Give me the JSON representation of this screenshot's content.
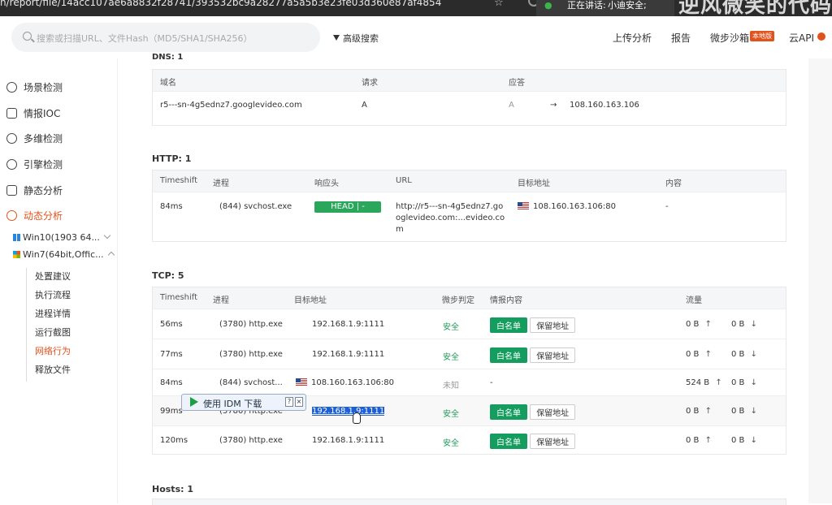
{
  "browser": {
    "url": "n/report/file/14acc107ae6a8832f28741/393532bc9a28277a5a5b3e23fe03d360e87af4854",
    "star_icon": "star-icon",
    "speaking_label": "正在讲话:",
    "speaker": "小迪安全;",
    "overlay_text": "逆风微笑的代码"
  },
  "header": {
    "search_placeholder": "搜索或扫描URL、文件Hash（MD5/SHA1/SHA256）",
    "advanced_search": "高级搜索",
    "nav": [
      "上传分析",
      "报告",
      "微步沙箱",
      "云API"
    ],
    "badge": "本地版"
  },
  "sidebar": {
    "items": [
      "场景检测",
      "情报IOC",
      "多维检测",
      "引擎检测",
      "静态分析",
      "动态分析"
    ],
    "vms": [
      "Win10(1903 64...",
      "Win7(64bit,Offic..."
    ],
    "subitems": [
      "处置建议",
      "执行流程",
      "进程详情",
      "运行截图",
      "网络行为",
      "释放文件"
    ]
  },
  "dns": {
    "title": "DNS: 1",
    "headers": [
      "域名",
      "请求",
      "应答"
    ],
    "rows": [
      {
        "domain": "r5---sn-4g5ednz7.googlevideo.com",
        "request": "A",
        "answer_type": "A",
        "answer": "108.160.163.106"
      }
    ]
  },
  "http": {
    "title": "HTTP: 1",
    "headers": [
      "Timeshift",
      "进程",
      "响应头",
      "URL",
      "目标地址",
      "内容"
    ],
    "rows": [
      {
        "time": "84ms",
        "process": "(844)  svchost.exe",
        "header": "HEAD  |  -",
        "url1": "http://r5---sn-4g5ednz7.go",
        "url2": "oglevideo.com:...evideo.co",
        "url3": "m",
        "target": "108.160.163.106:80",
        "content": "-"
      }
    ]
  },
  "tcp": {
    "title": "TCP: 5",
    "headers": [
      "Timeshift",
      "进程",
      "目标地址",
      "微步判定",
      "情报内容",
      "流量"
    ],
    "whitelist": "白名单",
    "reserved": "保留地址",
    "rows": [
      {
        "time": "56ms",
        "process": "(3780)  http.exe",
        "target": "192.168.1.9:1111",
        "verdict": "安全",
        "intel": "",
        "up": "0 B",
        "down": "0 B"
      },
      {
        "time": "77ms",
        "process": "(3780)  http.exe",
        "target": "192.168.1.9:1111",
        "verdict": "安全",
        "intel": "",
        "up": "0 B",
        "down": "0 B"
      },
      {
        "time": "84ms",
        "process": "(844)  svchost...",
        "target": "108.160.163.106:80",
        "verdict": "未知",
        "intel": "-",
        "up": "524 B",
        "down": "0 B"
      },
      {
        "time": "99ms",
        "process": "(3780)  http.exe",
        "target": "192.168.1.9:1111",
        "verdict": "安全",
        "intel": "",
        "up": "0 B",
        "down": "0 B"
      },
      {
        "time": "120ms",
        "process": "(3780)  http.exe",
        "target": "192.168.1.9:1111",
        "verdict": "安全",
        "intel": "",
        "up": "0 B",
        "down": "0 B"
      }
    ]
  },
  "hosts": {
    "title": "Hosts: 1"
  },
  "idm": {
    "label": "使用 IDM 下载",
    "help": "?",
    "close": "×"
  },
  "colors": {
    "accent": "#e1521c",
    "green": "#149d5e"
  }
}
